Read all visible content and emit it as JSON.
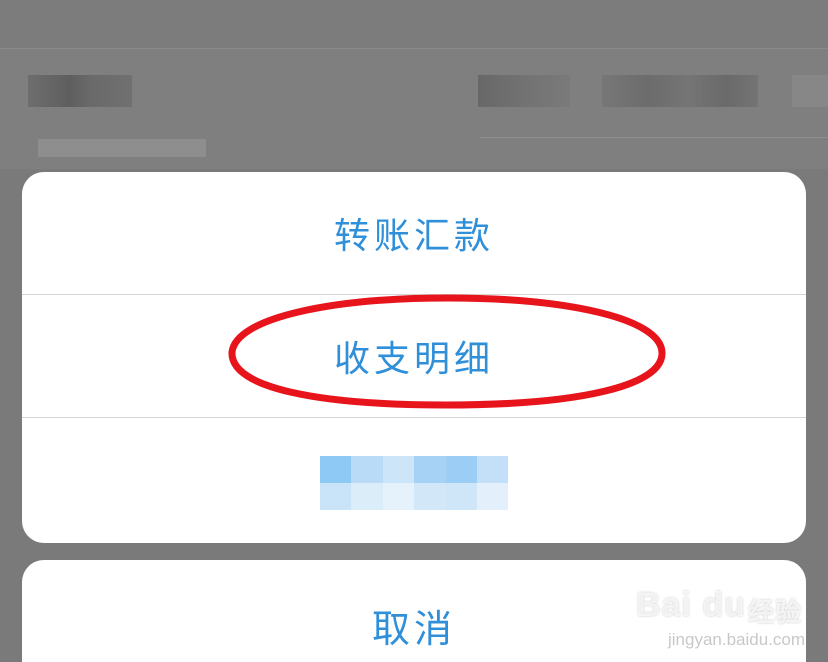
{
  "action_sheet": {
    "items": [
      {
        "label": "转账汇款"
      },
      {
        "label": "收支明细"
      },
      {
        "label": ""
      }
    ],
    "cancel_label": "取消"
  },
  "annotation": {
    "highlighted_item": "收支明细",
    "color": "#e8141c"
  },
  "watermark": {
    "brand": "Bai  du",
    "brand_cn": "经验",
    "url": "jingyan.baidu.com"
  },
  "colors": {
    "accent_text": "#2f8fd8",
    "overlay": "#7a7a7a",
    "sheet_bg": "#ffffff"
  }
}
